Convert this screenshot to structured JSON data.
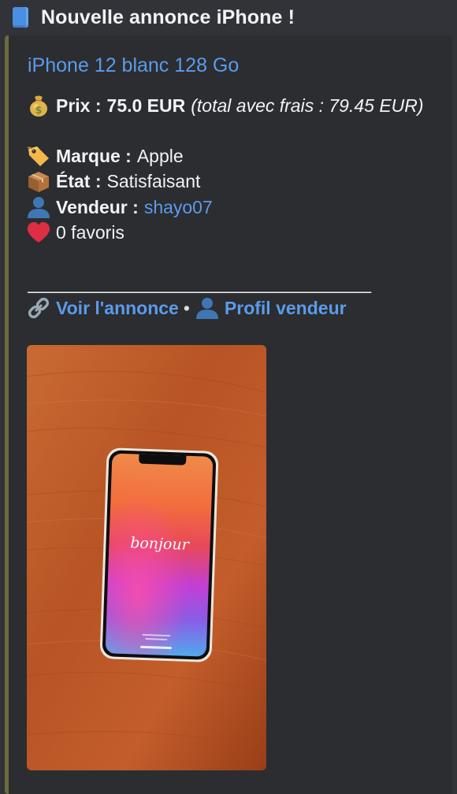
{
  "header": {
    "icon": "blue-square-icon",
    "title": "Nouvelle annonce iPhone !"
  },
  "embed": {
    "accent_color": "#6e6a3e",
    "title": "iPhone 12 blanc 128 Go",
    "price": {
      "icon": "money-bag-icon",
      "label": "Prix :",
      "value": "75.0 EUR",
      "total_note": "(total avec frais : 79.45 EUR)"
    },
    "brand": {
      "icon": "price-tag-icon",
      "label": "Marque :",
      "value": "Apple"
    },
    "condition": {
      "icon": "package-icon",
      "label": "État :",
      "value": "Satisfaisant"
    },
    "seller": {
      "icon": "person-silhouette-icon",
      "label": "Vendeur :",
      "value": "shayo07"
    },
    "favorites": {
      "icon": "red-heart-icon",
      "value": "0 favoris"
    },
    "divider": "————————————————————",
    "links": {
      "listing_icon": "link-icon",
      "listing_label": "Voir l'annonce",
      "separator": "•",
      "profile_icon": "person-silhouette-icon",
      "profile_label": "Profil vendeur"
    },
    "image": {
      "screen_text": "bonjour"
    }
  },
  "colors": {
    "background": "#313338",
    "embed_background": "#2b2d31",
    "link_blue": "#5c9bea",
    "text": "#f2f3f5"
  }
}
